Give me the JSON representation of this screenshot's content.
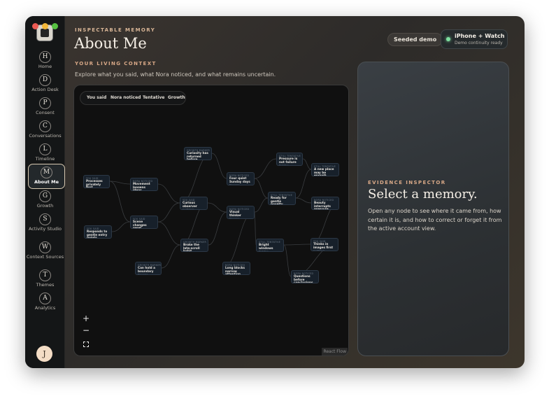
{
  "window": {
    "controls": [
      "close",
      "minimize",
      "zoom"
    ]
  },
  "sidebar": {
    "items": [
      {
        "letter": "H",
        "label": "Home",
        "icon": "home-icon"
      },
      {
        "letter": "D",
        "label": "Action Desk",
        "icon": "action-desk-icon"
      },
      {
        "letter": "P",
        "label": "Consent",
        "icon": "consent-icon"
      },
      {
        "letter": "C",
        "label": "Conversations",
        "icon": "conversations-icon"
      },
      {
        "letter": "L",
        "label": "Timeline",
        "icon": "timeline-icon"
      },
      {
        "letter": "M",
        "label": "About Me",
        "icon": "about-me-icon",
        "active": true
      },
      {
        "letter": "G",
        "label": "Growth",
        "icon": "growth-icon"
      },
      {
        "letter": "S",
        "label": "Activity Studio",
        "icon": "activity-studio-icon"
      },
      {
        "letter": "W",
        "label": "Context Sources",
        "icon": "context-sources-icon"
      },
      {
        "letter": "T",
        "label": "Themes",
        "icon": "themes-icon"
      },
      {
        "letter": "A",
        "label": "Analytics",
        "icon": "analytics-icon"
      }
    ],
    "avatar": "J"
  },
  "header": {
    "eyebrow": "INSPECTABLE MEMORY",
    "title": "About Me",
    "section_label": "YOUR LIVING CONTEXT",
    "section_desc": "Explore what you said, what Nora noticed, and what remains uncertain.",
    "seeded_pill": "Seeded demo",
    "device": {
      "title": "iPhone + Watch",
      "subtitle": "Demo continuity ready",
      "status_color": "#7ee0a0"
    }
  },
  "graph": {
    "tabs": [
      "You said",
      "Nora noticed",
      "Tentative",
      "Growth"
    ],
    "nodes": [
      {
        "id": "n1",
        "kind": "YOU SAID",
        "text": "Processes privately first",
        "conf": "Confirmed"
      },
      {
        "id": "n2",
        "kind": "YOU SAID",
        "text": "Responds to gentle entry points",
        "conf": "Confirmed"
      },
      {
        "id": "n3",
        "kind": "NORA NOTICED",
        "text": "Movement loosens ideas",
        "conf": "Emerging"
      },
      {
        "id": "n4",
        "kind": "YOU SAID",
        "text": "Scene changes reset attention",
        "conf": "Confirmed"
      },
      {
        "id": "n5",
        "kind": "GROWTH MARKER",
        "text": "Curiosity has returned before",
        "conf": "Emerging"
      },
      {
        "id": "n6",
        "kind": "YOU SAID",
        "text": "Curious observer",
        "conf": "Confirmed"
      },
      {
        "id": "n7",
        "kind": "GROWTH MARKER",
        "text": "Broke the late-scroll habit",
        "conf": "Confirmed"
      },
      {
        "id": "n8",
        "kind": "GROWTH MARKER",
        "text": "Can hold a boundary",
        "conf": "Emerging"
      },
      {
        "id": "n9",
        "kind": "NORA NOTICED",
        "text": "Four quiet Sunday days",
        "conf": "Emerging"
      },
      {
        "id": "n10",
        "kind": "NORA NOTICED",
        "text": "Visual thinker",
        "conf": "Emerging"
      },
      {
        "id": "n11",
        "kind": "NORA NOTICED",
        "text": "Long blocks narrow attention",
        "conf": "Emerging"
      },
      {
        "id": "n12",
        "kind": "STILL TENTATIVE",
        "text": "Pressure is not failure",
        "conf": "Tentative"
      },
      {
        "id": "n13",
        "kind": "STILL TENTATIVE",
        "text": "Ready for gentle novelty",
        "conf": "Tentative"
      },
      {
        "id": "n14",
        "kind": "STILL TENTATIVE",
        "text": "Bright windows",
        "conf": "Tentative"
      },
      {
        "id": "n15",
        "kind": "STILL TENTATIVE",
        "text": "A new place may be enough",
        "conf": "Tentative"
      },
      {
        "id": "n16",
        "kind": "NORA NOTICED",
        "text": "Beauty interrupts pressure",
        "conf": "Emerging"
      },
      {
        "id": "n17",
        "kind": "YOU SAID",
        "text": "Thinks in images first",
        "conf": "Confirmed"
      },
      {
        "id": "n18",
        "kind": "NORA NOTICED",
        "text": "Questions before conclusions",
        "conf": "Emerging"
      }
    ],
    "zoom_in": "+",
    "zoom_out": "−",
    "attribution": "React Flow"
  },
  "inspector": {
    "eyebrow": "EVIDENCE INSPECTOR",
    "title": "Select a memory.",
    "body": "Open any node to see where it came from, how certain it is, and how to correct or forget it from the active account view."
  }
}
